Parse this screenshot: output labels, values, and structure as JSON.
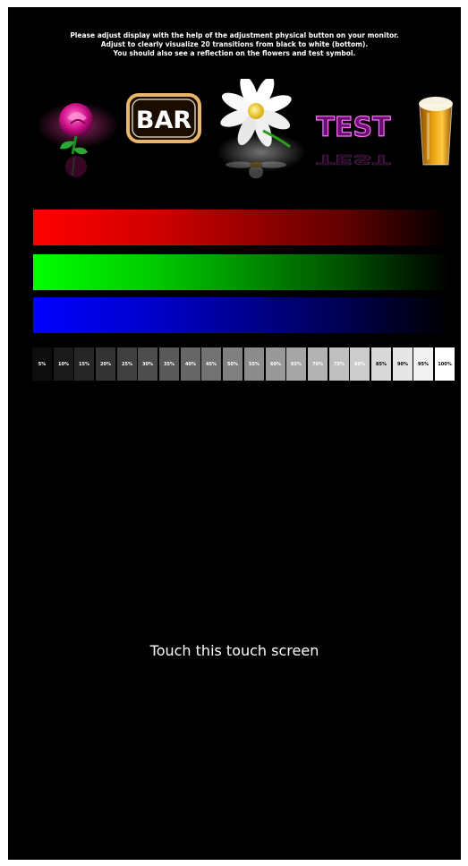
{
  "instructions": {
    "line1": "Please adjust display with the help of the adjustment physical button on your monitor.",
    "line2": "Adjust to clearly visualize 20 transitions from black to white (bottom).",
    "line3": "You should also see a reflection on the flowers and test symbol."
  },
  "symbols": {
    "rose": {
      "icon": "rose-icon"
    },
    "bar": {
      "icon": "bar-sign-icon",
      "label": "BAR"
    },
    "daisy": {
      "icon": "daisy-icon"
    },
    "test": {
      "icon": "test-sign-icon",
      "label": "TEST"
    },
    "beer": {
      "icon": "beer-glass-icon"
    }
  },
  "color_bars": [
    {
      "name": "red",
      "color": "#ff0000"
    },
    {
      "name": "green",
      "color": "#00ff00"
    },
    {
      "name": "blue",
      "color": "#0000ff"
    }
  ],
  "gray_scale": [
    "5%",
    "10%",
    "15%",
    "20%",
    "25%",
    "30%",
    "35%",
    "40%",
    "45%",
    "50%",
    "55%",
    "60%",
    "65%",
    "70%",
    "75%",
    "80%",
    "85%",
    "90%",
    "95%",
    "100%"
  ],
  "touch_prompt": "Touch this touch screen",
  "colors": {
    "background": "#000000",
    "text": "#ffffff",
    "bar_sign": "#e8b66a",
    "test_sign": "#e030e0"
  }
}
